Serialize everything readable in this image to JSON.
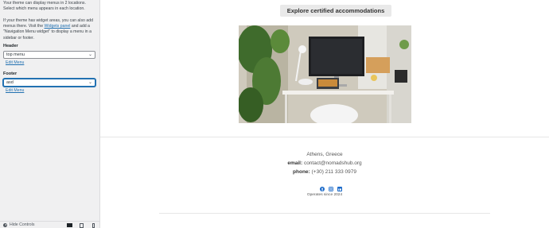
{
  "panel": {
    "intro_line1": "Your theme can display menus in 2 locations. Select which menu appears in each location.",
    "intro_pre": "If your theme has widget areas, you can also add menus there. Visit the ",
    "widgets_link": "Widgets panel",
    "intro_post": " and add a \"Navigation Menu widget\" to display a menu in a sidebar or footer.",
    "header_label": "Header",
    "header_value": "top menu",
    "header_edit": "Edit Menu",
    "footer_label": "Footer",
    "footer_value": "asd",
    "footer_edit": "Edit Menu",
    "hide_controls": "Hide Controls"
  },
  "preview": {
    "button": "Explore certified accommodations",
    "location": "Athens, Greece",
    "email_label": "email:",
    "email_value": "contact@nomadshub.org",
    "phone_label": "phone:",
    "phone_value": "(+30) 211 333 0979",
    "operates": "Operates since 2024"
  },
  "icons": [
    "facebook-icon",
    "instagram-icon",
    "linkedin-icon"
  ],
  "colors": {
    "accent": "#2271b1",
    "social": "#1b6ac9"
  }
}
